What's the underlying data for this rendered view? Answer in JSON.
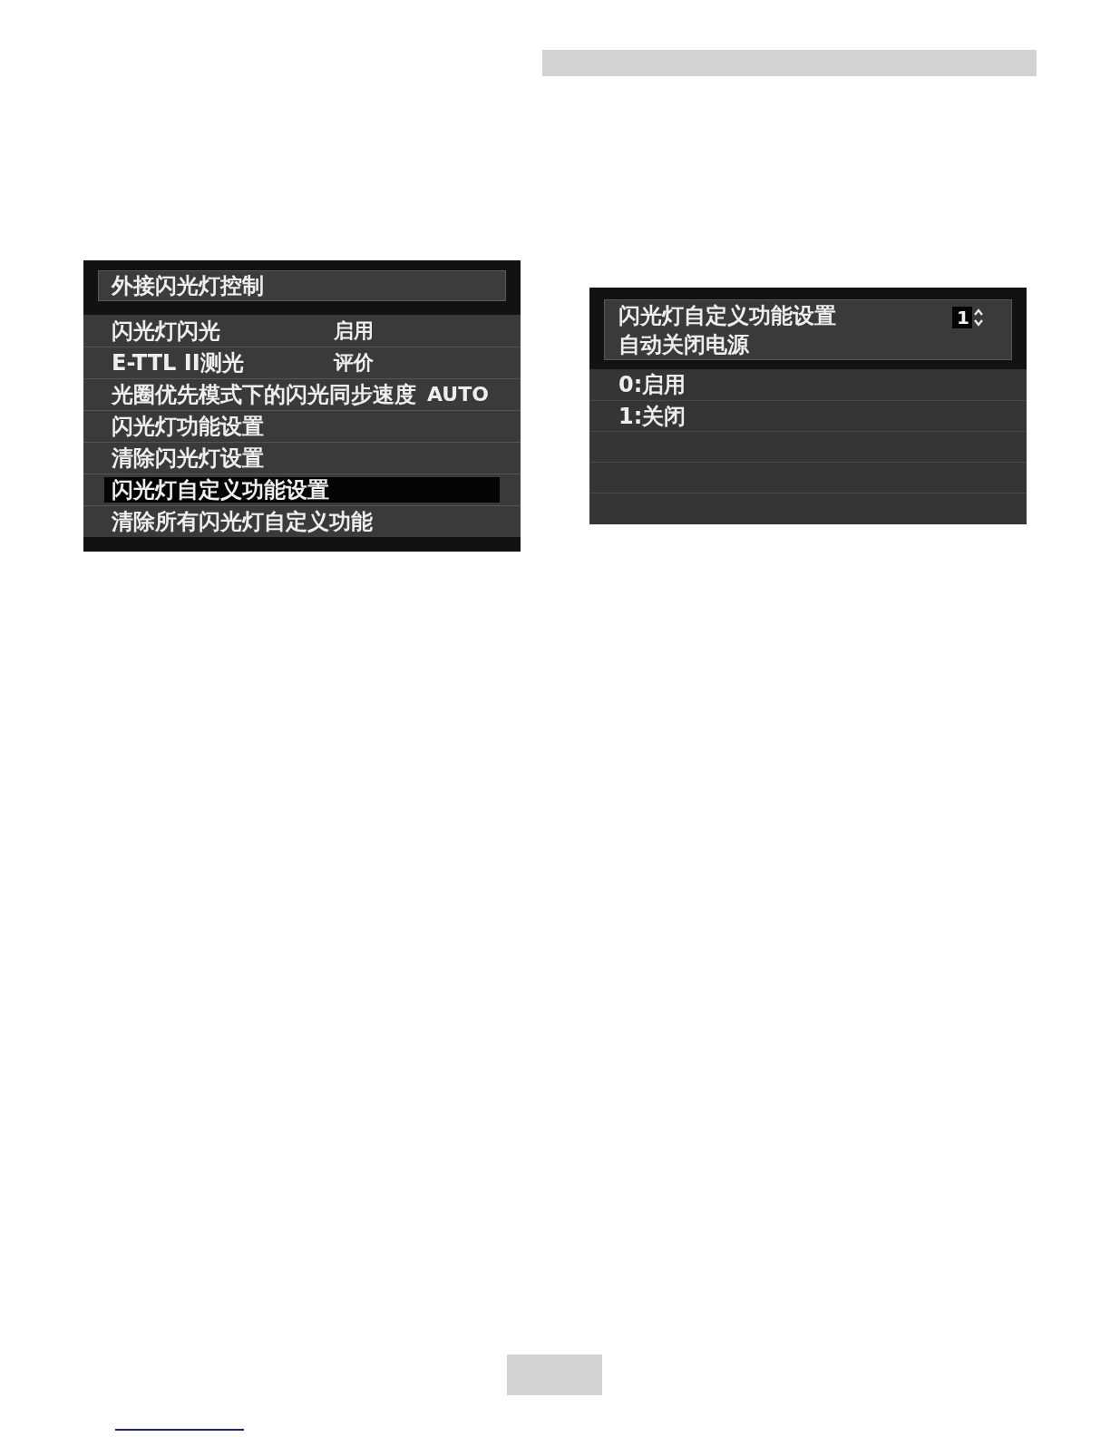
{
  "left_screen": {
    "title": "外接闪光灯控制",
    "items": [
      {
        "label": "闪光灯闪光",
        "value": "启用",
        "selected": false
      },
      {
        "label": "E-TTL II测光",
        "value": "评价",
        "selected": false
      },
      {
        "label": "光圈优先模式下的闪光同步速度",
        "value": "AUTO",
        "selected": false
      },
      {
        "label": "闪光灯功能设置",
        "selected": false
      },
      {
        "label": "清除闪光灯设置",
        "selected": false
      },
      {
        "label": "闪光灯自定义功能设置",
        "selected": true
      },
      {
        "label": "清除所有闪光灯自定义功能",
        "selected": false
      }
    ]
  },
  "right_screen": {
    "title": "闪光灯自定义功能设置",
    "subtitle": "自动关闭电源",
    "value": "1",
    "options": [
      {
        "label": "0:启用"
      },
      {
        "label": "1:关闭"
      }
    ]
  }
}
